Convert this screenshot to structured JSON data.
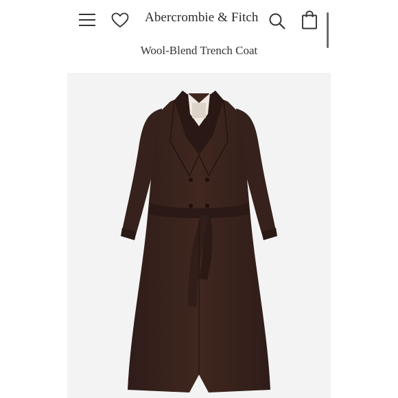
{
  "header": {
    "menu_icon": "hamburger-menu-icon",
    "wishlist_icon": "heart-icon",
    "brand": "Abercrombie & Fitch",
    "search_icon": "search-icon",
    "bag_icon": "shopping-bag-icon"
  },
  "product": {
    "title": "Wool-Blend Trench Coat",
    "image": {
      "subject": "trench-coat",
      "coat_color": "#3b2420",
      "background_color": "#f3f3f3"
    }
  }
}
